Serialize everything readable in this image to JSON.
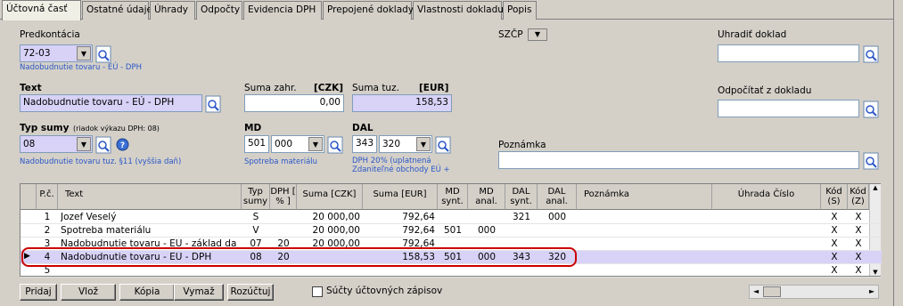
{
  "tabs": [
    "Účtovná časť",
    "Ostatné údaje",
    "Úhrady",
    "Odpočty",
    "Evidencia DPH",
    "Prepojené doklady",
    "Vlastnosti dokladu",
    "Popis"
  ],
  "predkontacia": {
    "label": "Predkontácia",
    "value": "72-03",
    "desc": "Nadobudnutie tovaru - EÚ - DPH"
  },
  "szcp": {
    "label": "SZČP"
  },
  "uhradit": {
    "label": "Uhradiť doklad",
    "value": ""
  },
  "odpocitat": {
    "label": "Odpočítať z dokladu",
    "value": ""
  },
  "text": {
    "label": "Text",
    "value": "Nadobudnutie tovaru - EÚ - DPH"
  },
  "suma_zahr": {
    "label": "Suma zahr.",
    "currency": "[CZK]",
    "value": "0,00"
  },
  "suma_tuz": {
    "label": "Suma tuz.",
    "currency": "[EUR]",
    "value": "158,53"
  },
  "typ_sumy": {
    "label": "Typ sumy",
    "hint": "(riadok výkazu DPH: 08)",
    "value": "08",
    "desc": "Nadobudnutie tovaru tuz. §11 (vyššia daň)"
  },
  "md": {
    "label": "MD",
    "synt": "501",
    "anal": "000",
    "desc": "Spotreba materiálu"
  },
  "dal": {
    "label": "DAL",
    "synt": "343",
    "anal": "320",
    "desc1": "DPH 20% (uplatnená",
    "desc2": "Zdaniteľné obchody EÚ +"
  },
  "poznamka": {
    "label": "Poznámka",
    "value": ""
  },
  "columns": [
    "P.č.",
    "Text",
    "Typ sumy",
    "DPH [ % ]",
    "Suma [CZK]",
    "Suma [EUR]",
    "MD synt.",
    "MD anal.",
    "DAL synt.",
    "DAL anal.",
    "Poznámka",
    "Úhrada Číslo",
    "Kód (S)",
    "Kód (Z)"
  ],
  "rows": [
    {
      "pc": "1",
      "text": "Jozef Veselý",
      "typ": "S",
      "dph": "",
      "czk": "20 000,00",
      "eur": "792,64",
      "mds": "",
      "mda": "",
      "dals": "321",
      "dala": "000",
      "poz": "",
      "uhr": "",
      "ks": "X",
      "kz": "X"
    },
    {
      "pc": "2",
      "text": "Spotreba materiálu",
      "typ": "V",
      "dph": "",
      "czk": "20 000,00",
      "eur": "792,64",
      "mds": "501",
      "mda": "000",
      "dals": "",
      "dala": "",
      "poz": "",
      "uhr": "",
      "ks": "X",
      "kz": "X"
    },
    {
      "pc": "3",
      "text": "Nadobudnutie tovaru - EÚ - základ da",
      "typ": "07",
      "dph": "20",
      "czk": "20 000,00",
      "eur": "792,64",
      "mds": "",
      "mda": "",
      "dals": "",
      "dala": "",
      "poz": "",
      "uhr": "",
      "ks": "X",
      "kz": "X"
    },
    {
      "pc": "4",
      "text": "Nadobudnutie tovaru - EÚ - DPH",
      "typ": "08",
      "dph": "20",
      "czk": "",
      "eur": "158,53",
      "mds": "501",
      "mda": "000",
      "dals": "343",
      "dala": "320",
      "poz": "",
      "uhr": "",
      "ks": "X",
      "kz": "X"
    },
    {
      "pc": "5",
      "text": "",
      "typ": "",
      "dph": "",
      "czk": "",
      "eur": "",
      "mds": "",
      "mda": "",
      "dals": "",
      "dala": "",
      "poz": "",
      "uhr": "",
      "ks": "X",
      "kz": "X"
    }
  ],
  "buttons": [
    "Pridaj",
    "Vlož",
    "Kópia",
    "Vymaž",
    "Rozúčtuj"
  ],
  "sucty": {
    "label": "Súčty účtovných zápisov",
    "checked": false
  },
  "colors": {
    "accent": "#2b57c8",
    "selected_row": "#d8d2f7",
    "highlight": "#cc0000"
  }
}
